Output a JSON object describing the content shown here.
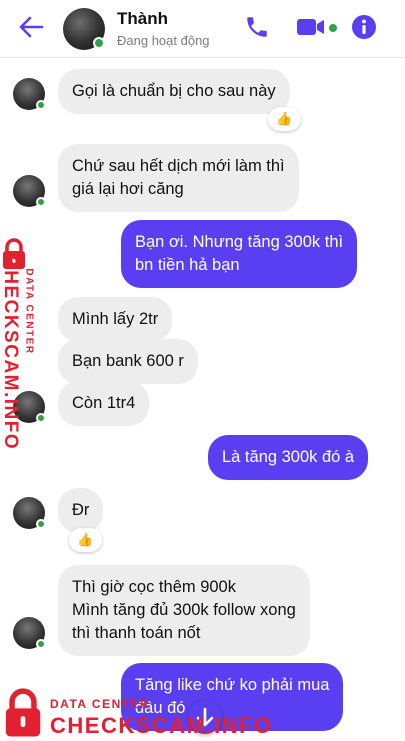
{
  "header": {
    "name": "Thành",
    "status": "Đang hoạt động",
    "accent": "#5a3ff2",
    "online_color": "#31a24c"
  },
  "messages": [
    {
      "from": "them",
      "text": "Gọi là chuẩn bị cho sau này",
      "reaction": "👍"
    },
    {
      "from": "them",
      "lines": [
        "Chứ sau hết dịch mới làm thì",
        "giá lại hơi căng"
      ]
    },
    {
      "from": "me",
      "lines": [
        "Bạn ơi. Nhưng tăng 300k thì",
        "bn tiền hả bạn"
      ]
    },
    {
      "from": "them",
      "text": "Mình lấy 2tr"
    },
    {
      "from": "them",
      "text": "Bạn bank 600 r"
    },
    {
      "from": "them",
      "text": "Còn 1tr4"
    },
    {
      "from": "me",
      "text": "Là tăng 300k đó à"
    },
    {
      "from": "them",
      "text": "Đr",
      "reaction": "👍"
    },
    {
      "from": "them",
      "lines": [
        "Thì giờ cọc thêm 900k",
        "Mình tăng đủ 300k follow xong",
        "thì thanh toán nốt"
      ]
    },
    {
      "from": "me",
      "lines": [
        "Tăng like chứ ko phải mua",
        "đâu đó"
      ]
    }
  ],
  "watermark": {
    "title": "CHECKSCAM.INFO",
    "subtitle": "DATA CENTER",
    "color": "#e2202f"
  }
}
